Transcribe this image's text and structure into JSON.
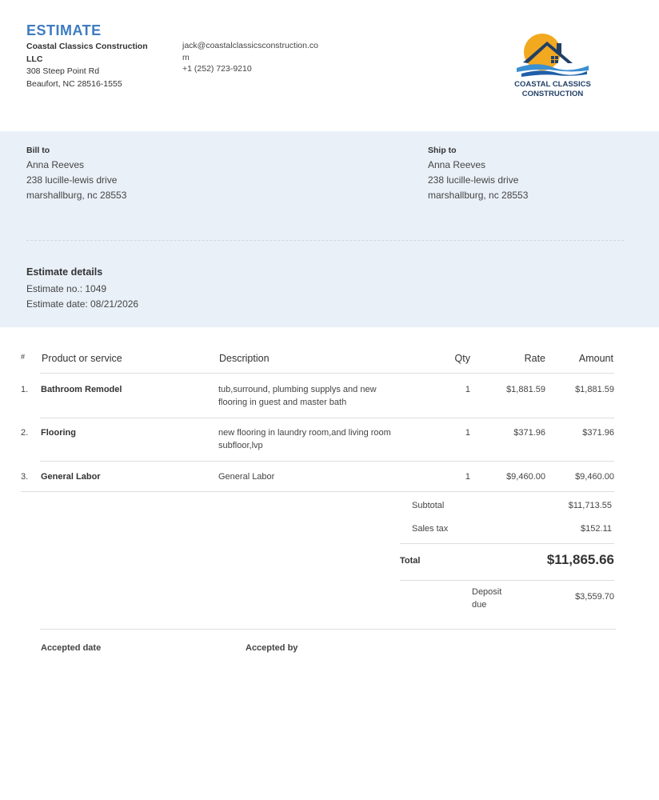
{
  "document": {
    "title": "ESTIMATE"
  },
  "company": {
    "name": "Coastal Classics Construction LLC",
    "address_line1": "308 Steep Point Rd",
    "address_line2": "Beaufort, NC 28516-1555",
    "email": "jack@coastalclassicsconstruction.com",
    "phone": "+1 (252) 723-9210",
    "logo_text_line1": "COASTAL CLASSICS",
    "logo_text_line2": "CONSTRUCTION"
  },
  "bill_to": {
    "label": "Bill to",
    "name": "Anna Reeves",
    "line1": "238 lucille-lewis drive",
    "line2": "marshallburg, nc 28553"
  },
  "ship_to": {
    "label": "Ship to",
    "name": "Anna Reeves",
    "line1": "238 lucille-lewis drive",
    "line2": "marshallburg, nc 28553"
  },
  "estimate_details": {
    "label": "Estimate details",
    "number": "Estimate no.: 1049",
    "date": "Estimate date: 08/21/2026"
  },
  "table": {
    "headers": {
      "num": "#",
      "product": "Product or service",
      "description": "Description",
      "qty": "Qty",
      "rate": "Rate",
      "amount": "Amount"
    },
    "rows": [
      {
        "num": "1.",
        "product": "Bathroom Remodel",
        "description": "tub,surround, plumbing supplys and new flooring in guest and master bath",
        "qty": "1",
        "rate": "$1,881.59",
        "amount": "$1,881.59"
      },
      {
        "num": "2.",
        "product": "Flooring",
        "description": "new flooring in laundry room,and living room subfloor,lvp",
        "qty": "1",
        "rate": "$371.96",
        "amount": "$371.96"
      },
      {
        "num": "3.",
        "product": "General Labor",
        "description": "General Labor",
        "qty": "1",
        "rate": "$9,460.00",
        "amount": "$9,460.00"
      }
    ]
  },
  "totals": {
    "subtotal_label": "Subtotal",
    "subtotal": "$11,713.55",
    "tax_label": "Sales tax",
    "tax": "$152.11",
    "total_label": "Total",
    "total": "$11,865.66",
    "deposit_label": "Deposit due",
    "deposit": "$3,559.70"
  },
  "acceptance": {
    "date_label": "Accepted date",
    "by_label": "Accepted by"
  },
  "colors": {
    "accent": "#3e7cc0",
    "band": "#e9f0f8",
    "logo_sun": "#f2a91f",
    "logo_navy": "#213f66",
    "logo_wave": "#3b8fd3"
  }
}
